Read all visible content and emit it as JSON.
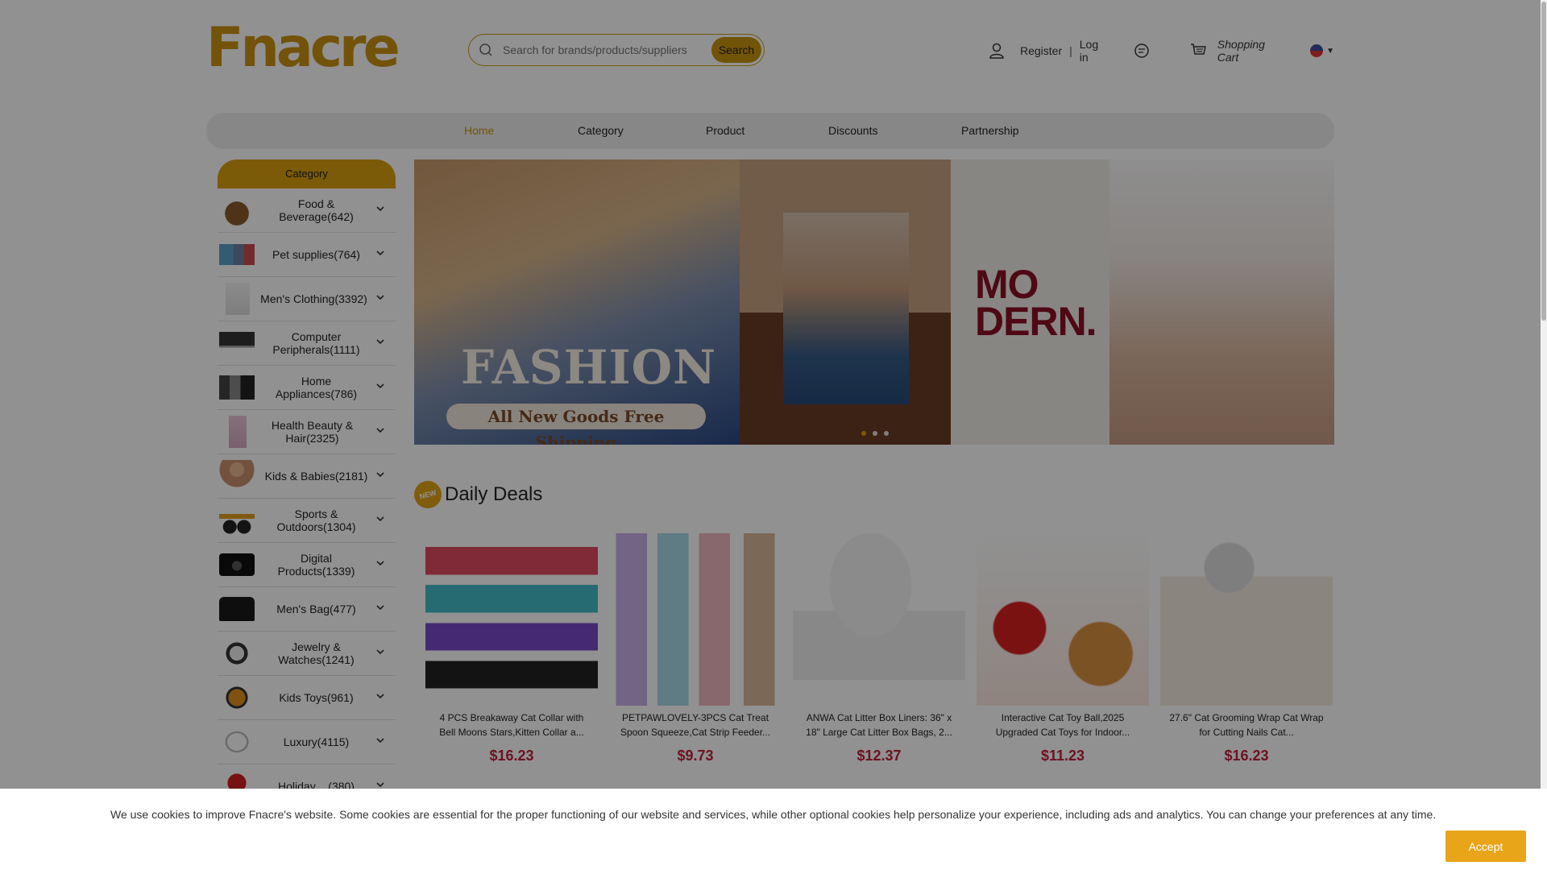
{
  "header": {
    "logo": "Fnacre",
    "search_placeholder": "Search for brands/products/suppliers",
    "search_button": "Search",
    "register": "Register",
    "separator": "|",
    "login": "Log in",
    "cart": "Shopping Cart"
  },
  "nav": {
    "items": [
      "Home",
      "Category",
      "Product",
      "Discounts",
      "Partnership"
    ],
    "active": "Home"
  },
  "sidebar": {
    "title": "Category",
    "items": [
      {
        "label": "Food & Beverage(642)"
      },
      {
        "label": "Pet supplies(764)"
      },
      {
        "label": "Men's Clothing(3392)"
      },
      {
        "label": "Computer Peripherals(1111)"
      },
      {
        "label": "Home Appliances(786)"
      },
      {
        "label": "Health Beauty & Hair(2325)"
      },
      {
        "label": "Kids & Babies(2181)"
      },
      {
        "label": "Sports & Outdoors(1304)"
      },
      {
        "label": "Digital Products(1339)"
      },
      {
        "label": "Men's Bag(477)"
      },
      {
        "label": "Jewelry & Watches(1241)"
      },
      {
        "label": "Kids Toys(961)"
      },
      {
        "label": "Luxury(4115)"
      },
      {
        "label": "Holiday ...(380)"
      }
    ]
  },
  "banner": {
    "title": "FASHION",
    "subtitle": "All New Goods Free Shipping",
    "modern_line1": "MO",
    "modern_line2": "DERN."
  },
  "deals": {
    "badge": "NEW",
    "title": "Daily Deals",
    "products": [
      {
        "name": "4 PCS Breakaway Cat Collar with Bell Moons Stars,Kitten Collar a...",
        "price": "$16.23"
      },
      {
        "name": "PETPAWLOVELY-3PCS Cat Treat Spoon Squeeze,Cat Strip Feeder...",
        "price": "$9.73"
      },
      {
        "name": "ANWA Cat Litter Box Liners: 36\" x 18\" Large Cat Litter Box Bags, 2...",
        "price": "$12.37"
      },
      {
        "name": "Interactive Cat Toy Ball,2025 Upgraded Cat Toys for Indoor...",
        "price": "$11.23"
      },
      {
        "name": "27.6\" Cat Grooming Wrap Cat Wrap for Cutting Nails Cat...",
        "price": "$16.23"
      }
    ]
  },
  "cookie": {
    "text": "We use cookies to improve Fnacre's website. Some cookies are essential for the proper functioning of our website and services, while other optional cookies help personalize your experience, including ads and analytics. You can change your preferences at any time.",
    "accept": "Accept"
  },
  "colors": {
    "brand": "#c89210",
    "accent": "#d89e0f",
    "price": "#c0203a"
  }
}
